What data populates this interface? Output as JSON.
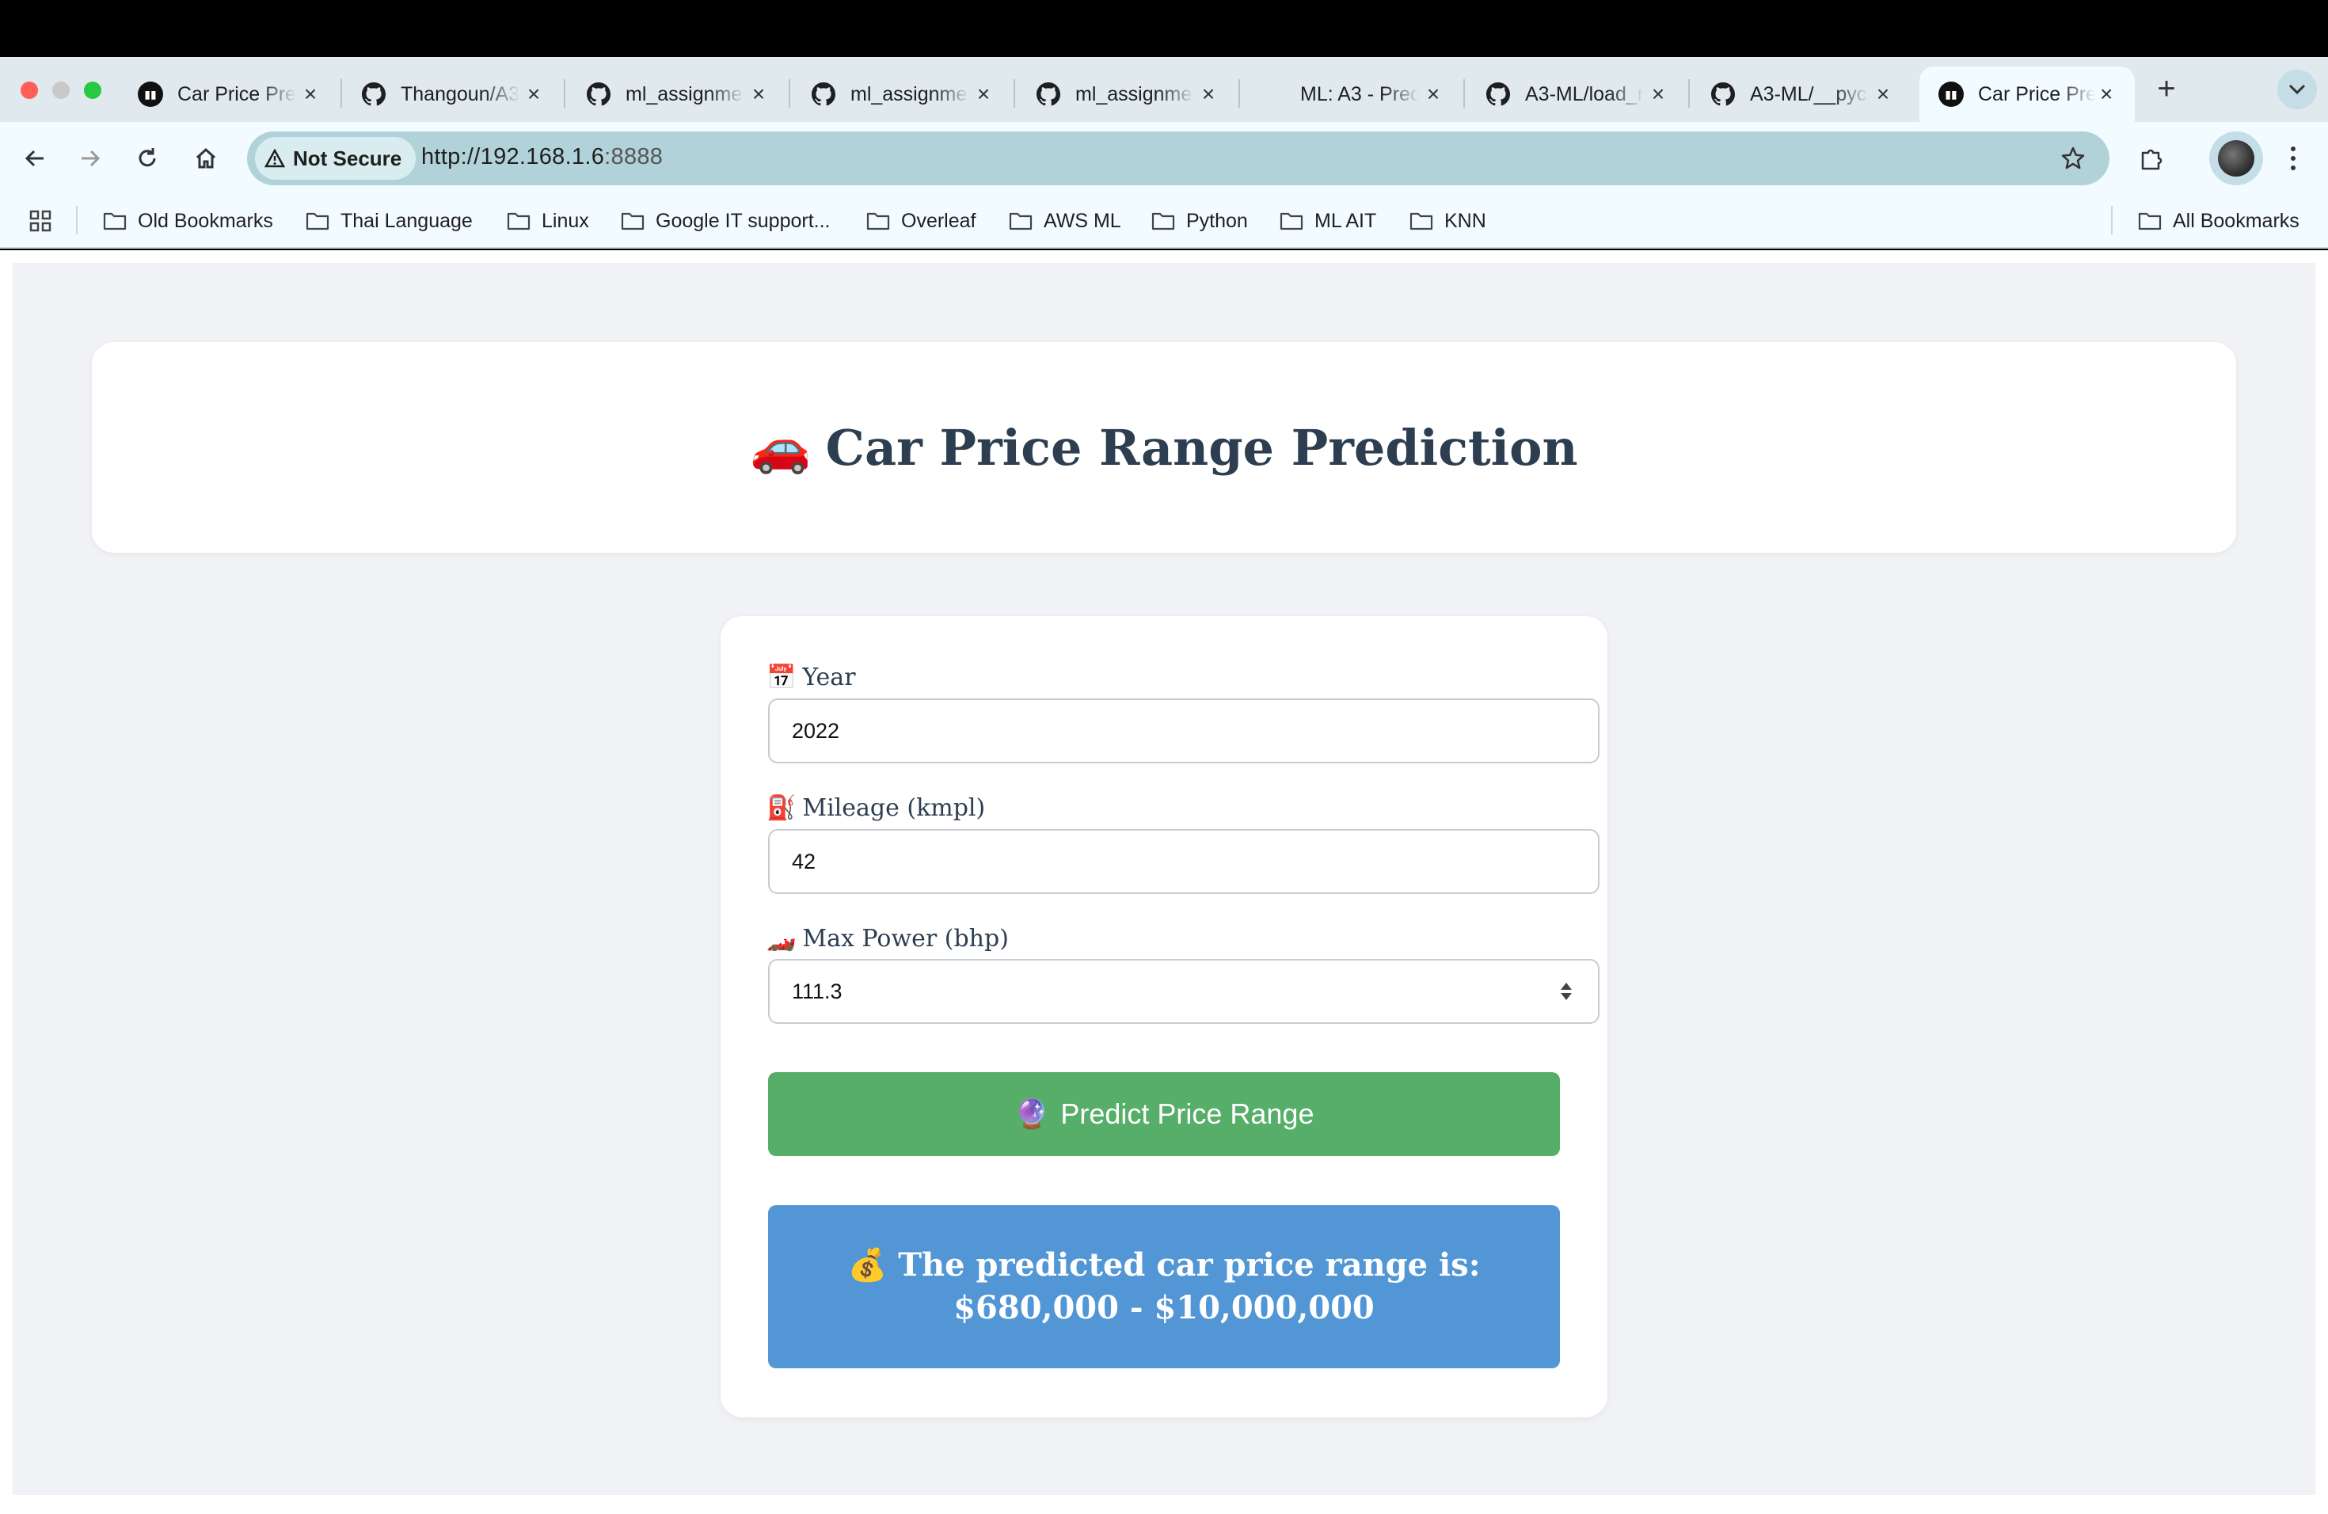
{
  "browser": {
    "tabs": [
      {
        "title": "Car Price Prediction",
        "favicon": "app-icon",
        "active": false
      },
      {
        "title": "Thangoun/A3-ML",
        "favicon": "github-icon",
        "active": false
      },
      {
        "title": "ml_assignment",
        "favicon": "github-icon",
        "active": false
      },
      {
        "title": "ml_assignment",
        "favicon": "github-icon",
        "active": false
      },
      {
        "title": "ml_assignment",
        "favicon": "github-icon",
        "active": false
      },
      {
        "title": "ML: A3 - Predict",
        "favicon": "none",
        "active": false
      },
      {
        "title": "A3-ML/load_model",
        "favicon": "github-icon",
        "active": false
      },
      {
        "title": "A3-ML/__pycache__",
        "favicon": "github-icon",
        "active": false
      },
      {
        "title": "Car Price Prediction",
        "favicon": "app-icon",
        "active": true
      }
    ],
    "security_label": "Not Secure",
    "url_host": "http://192.168.1.6",
    "url_port": ":8888",
    "bookmarks": [
      "Old Bookmarks",
      "Thai Language",
      "Linux",
      "Google IT support...",
      "Overleaf",
      "AWS ML",
      "Python",
      "ML AIT",
      "KNN"
    ],
    "all_bookmarks": "All Bookmarks"
  },
  "page": {
    "title_emoji": "🚗",
    "title": "Car Price Range Prediction",
    "fields": {
      "year": {
        "emoji": "📅",
        "label": "Year",
        "value": "2022"
      },
      "mileage": {
        "emoji": "⛽",
        "label": "Mileage (kmpl)",
        "value": "42"
      },
      "max_power": {
        "emoji": "🏎️",
        "label": "Max Power (bhp)",
        "value": "111.3"
      }
    },
    "predict_button": {
      "emoji": "🔮",
      "label": "Predict Price Range"
    },
    "result": {
      "emoji": "💰",
      "text": "The predicted car price range is: $680,000 - $10,000,000"
    }
  },
  "colors": {
    "accent_green": "#56ae68",
    "result_blue": "#5296d5",
    "heading": "#2c3e50",
    "page_bg": "#f0f2f5"
  }
}
